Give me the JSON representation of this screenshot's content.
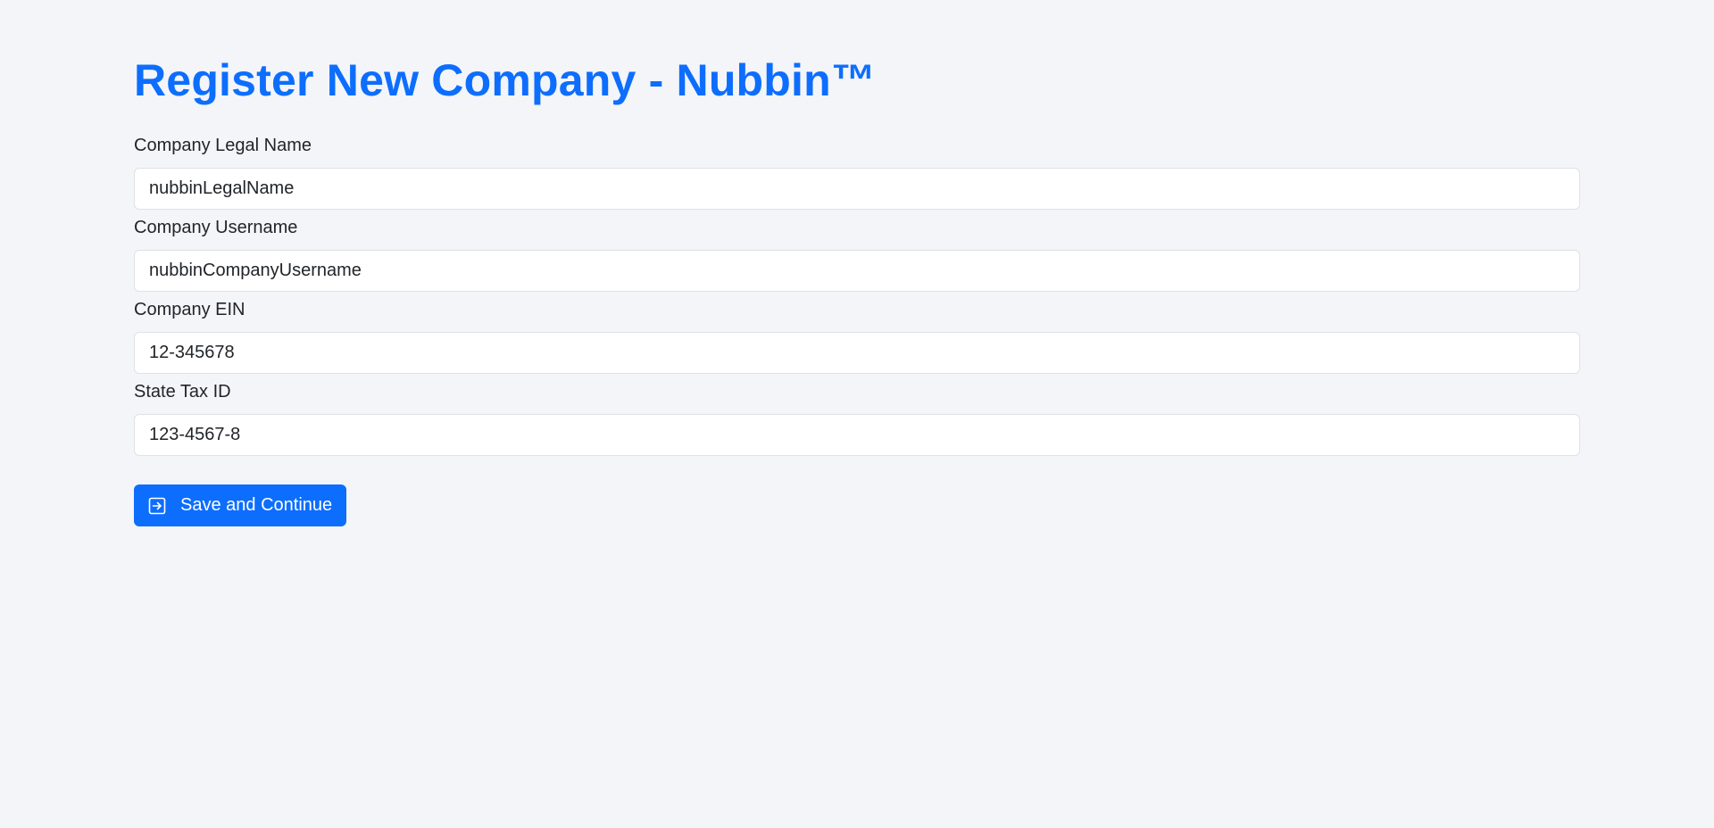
{
  "page": {
    "title": "Register New Company - Nubbin™"
  },
  "form": {
    "fields": [
      {
        "label": "Company Legal Name",
        "value": "nubbinLegalName"
      },
      {
        "label": "Company Username",
        "value": "nubbinCompanyUsername"
      },
      {
        "label": "Company EIN",
        "value": "12-345678"
      },
      {
        "label": "State Tax ID",
        "value": "123-4567-8"
      }
    ],
    "submit": {
      "label": "Save and Continue",
      "icon": "box-arrow-in-right-icon"
    }
  },
  "colors": {
    "accent": "#0d6efd",
    "background": "#f3f5f9",
    "input_border": "#dee2e6"
  }
}
